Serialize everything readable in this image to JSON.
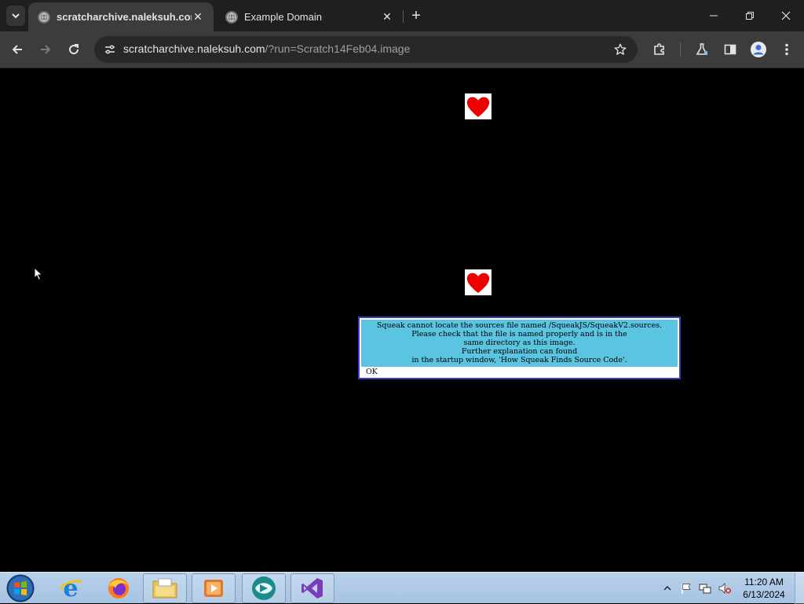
{
  "browser": {
    "tabs": [
      {
        "title": "scratcharchive.naleksuh.com/?r",
        "active": true
      },
      {
        "title": "Example Domain",
        "active": false
      }
    ],
    "url_host": "scratcharchive.naleksuh.com",
    "url_path": "/?run=Scratch14Feb04.image"
  },
  "page": {
    "background": "#000000",
    "sprite_icon": "heart-icon",
    "dialog": {
      "lines": [
        "Squeak cannot locate the sources file named /SqueakJS/SqueakV2.sources.",
        "Please check that the file is named properly and is in the",
        "same directory as this image.",
        "Further explanation can found",
        "in the startup window, 'How Squeak Finds Source Code'."
      ],
      "ok_label": "OK",
      "accent": "#5bc4e0"
    }
  },
  "taskbar": {
    "time": "11:20 AM",
    "date": "6/13/2024",
    "apps": [
      "start-orb",
      "internet-explorer",
      "firefox",
      "file-explorer",
      "media-player",
      "vpn-app",
      "visual-studio"
    ]
  }
}
